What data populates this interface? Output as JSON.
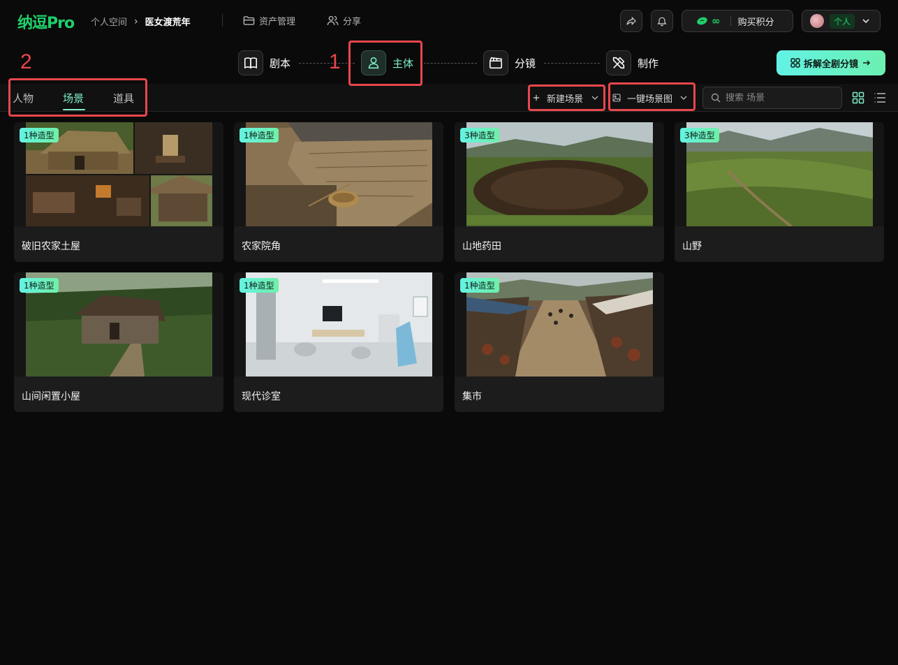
{
  "app": {
    "logo": "纳逗Pro"
  },
  "breadcrumb": {
    "space": "个人空间",
    "separator": "›",
    "project": "医女渡荒年"
  },
  "topnav": {
    "assets": "资产管理",
    "share": "分享"
  },
  "credits": {
    "amount": "∞",
    "buy": "购买积分"
  },
  "user": {
    "badge": "个人"
  },
  "steps": [
    {
      "label": "剧本",
      "icon": "book-icon"
    },
    {
      "label": "主体",
      "icon": "person-icon"
    },
    {
      "label": "分镜",
      "icon": "clapperboard-icon"
    },
    {
      "label": "制作",
      "icon": "tools-icon"
    }
  ],
  "cta": {
    "label": "拆解全剧分镜"
  },
  "annotations": {
    "one": "1",
    "two": "2"
  },
  "tabs": [
    "人物",
    "场景",
    "道具"
  ],
  "toolbar": {
    "new_scene": "新建场景",
    "one_click": "一键场景图",
    "search_placeholder": "搜索 场景"
  },
  "scenes": [
    {
      "name": "破旧农家土屋",
      "badge": "1种造型"
    },
    {
      "name": "农家院角",
      "badge": "1种造型"
    },
    {
      "name": "山地药田",
      "badge": "3种造型"
    },
    {
      "name": "山野",
      "badge": "3种造型"
    },
    {
      "name": "山间闲置小屋",
      "badge": "1种造型"
    },
    {
      "name": "现代诊室",
      "badge": "1种造型"
    },
    {
      "name": "集市",
      "badge": "1种造型"
    }
  ],
  "colors": {
    "accent": "#1fcf6a",
    "mint": "#7ff0c8",
    "annotation": "#e8474c",
    "background": "#0a0a0a"
  }
}
